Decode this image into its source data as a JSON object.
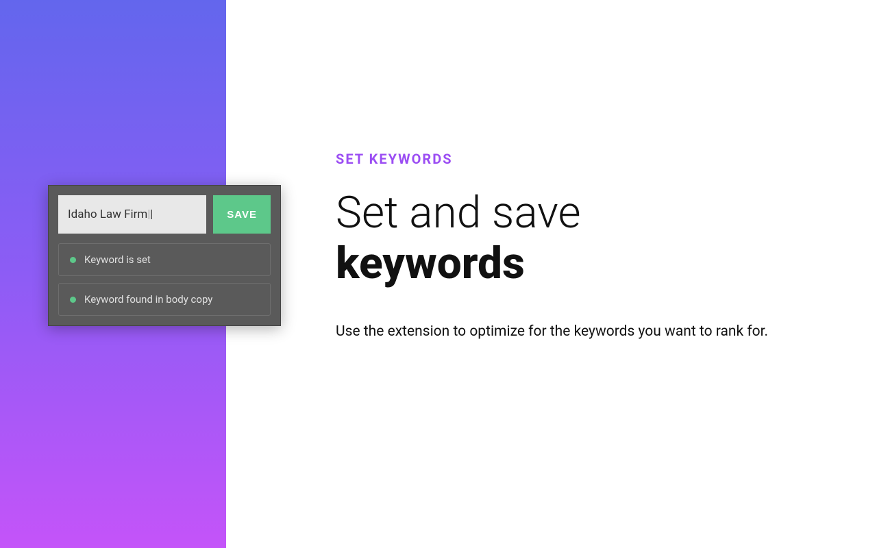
{
  "widget": {
    "keyword_input_value": "Idaho Law Firm",
    "save_button_label": "SAVE",
    "status_items": [
      {
        "text": "Keyword is set"
      },
      {
        "text": "Keyword found in body copy"
      }
    ]
  },
  "content": {
    "eyebrow": "SET KEYWORDS",
    "heading_line1": "Set and save",
    "heading_line2": "keywords",
    "description": "Use the extension to optimize for the keywords you want to rank for."
  },
  "colors": {
    "accent_purple": "#9b4df3",
    "success_green": "#5dc88a",
    "gradient_start": "#6366ed",
    "gradient_end": "#c454f9"
  }
}
